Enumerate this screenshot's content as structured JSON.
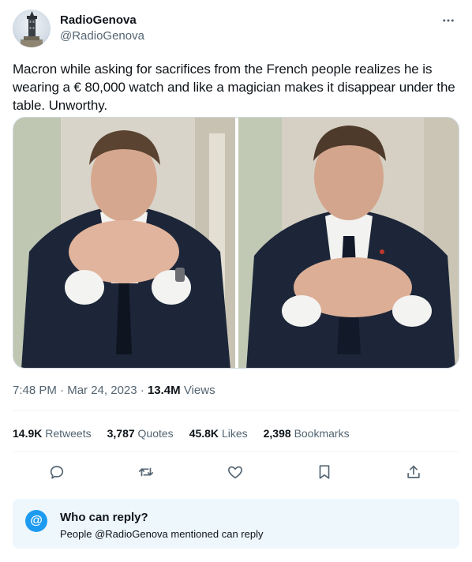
{
  "author": {
    "name": "RadioGenova",
    "handle": "@RadioGenova"
  },
  "tweet": {
    "text": "Macron while asking for sacrifices from the French people realizes he is wearing a € 80,000 watch and like a magician makes it disappear under the table. Unworthy."
  },
  "meta": {
    "time": "7:48 PM",
    "separator1": " · ",
    "date": "Mar 24, 2023",
    "separator2": " · ",
    "views_count": "13.4M",
    "views_label": " Views"
  },
  "stats": [
    {
      "count": "14.9K",
      "label": "Retweets"
    },
    {
      "count": "3,787",
      "label": "Quotes"
    },
    {
      "count": "45.8K",
      "label": "Likes"
    },
    {
      "count": "2,398",
      "label": "Bookmarks"
    }
  ],
  "actions": [
    {
      "icon": "reply-icon"
    },
    {
      "icon": "retweet-icon"
    },
    {
      "icon": "like-icon"
    },
    {
      "icon": "bookmark-icon"
    },
    {
      "icon": "share-icon"
    }
  ],
  "reply_settings": {
    "icon_glyph": "@",
    "title": "Who can reply?",
    "subtitle": "People @RadioGenova mentioned can reply"
  },
  "colors": {
    "accent": "#1d9bf0",
    "secondary_text": "#536471",
    "reply_box_bg": "#eef7fc"
  }
}
